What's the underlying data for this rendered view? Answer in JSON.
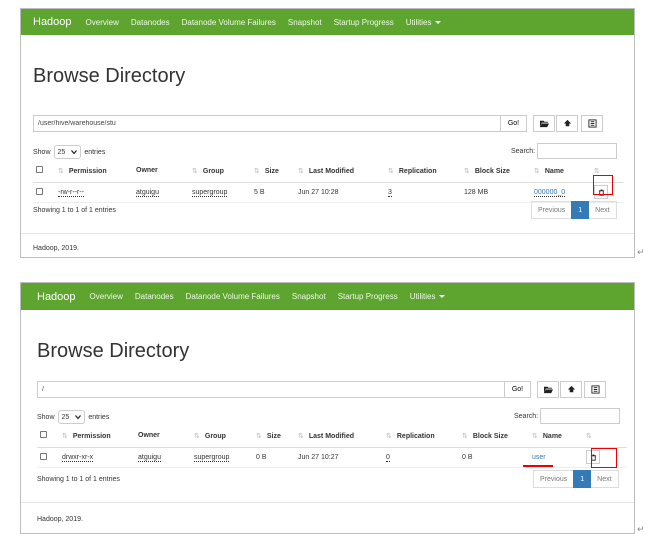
{
  "shared": {
    "brand": "Hadoop",
    "nav": [
      "Overview",
      "Datanodes",
      "Datanode Volume Failures",
      "Snapshot",
      "Startup Progress",
      "Utilities"
    ],
    "title": "Browse Directory",
    "go_label": "Go!",
    "show_label": "Show",
    "entries_value": "25",
    "entries_label": "entries",
    "search_label": "Search:",
    "columns": [
      "Permission",
      "Owner",
      "Group",
      "Size",
      "Last Modified",
      "Replication",
      "Block Size",
      "Name"
    ],
    "pager": {
      "previous": "Previous",
      "page": "1",
      "next": "Next"
    },
    "footer": "Hadoop, 2019.",
    "return_mark": "↵"
  },
  "panel1": {
    "path": "/user/hive/warehouse/stu",
    "row": {
      "permission": "-rw-r--r--",
      "owner": "atguigu",
      "group": "supergroup",
      "size": "5 B",
      "modified": "Jun 27 10:28",
      "replication": "3",
      "block_size": "128 MB",
      "name": "000000_0"
    },
    "showing": "Showing 1 to 1 of 1 entries"
  },
  "panel2": {
    "path": "/",
    "row": {
      "permission": "drwxr-xr-x",
      "owner": "atguigu",
      "group": "supergroup",
      "size": "0 B",
      "modified": "Jun 27 10:27",
      "replication": "0",
      "block_size": "0 B",
      "name": "user"
    },
    "showing": "Showing 1 to 1 of 1 entries"
  },
  "colors": {
    "navbar": "#5ea530",
    "link": "#337ab7",
    "highlight": "#e00000"
  },
  "icons": [
    "folder-open-icon",
    "upload-icon",
    "list-icon",
    "trash-icon",
    "chevron-down-icon"
  ]
}
